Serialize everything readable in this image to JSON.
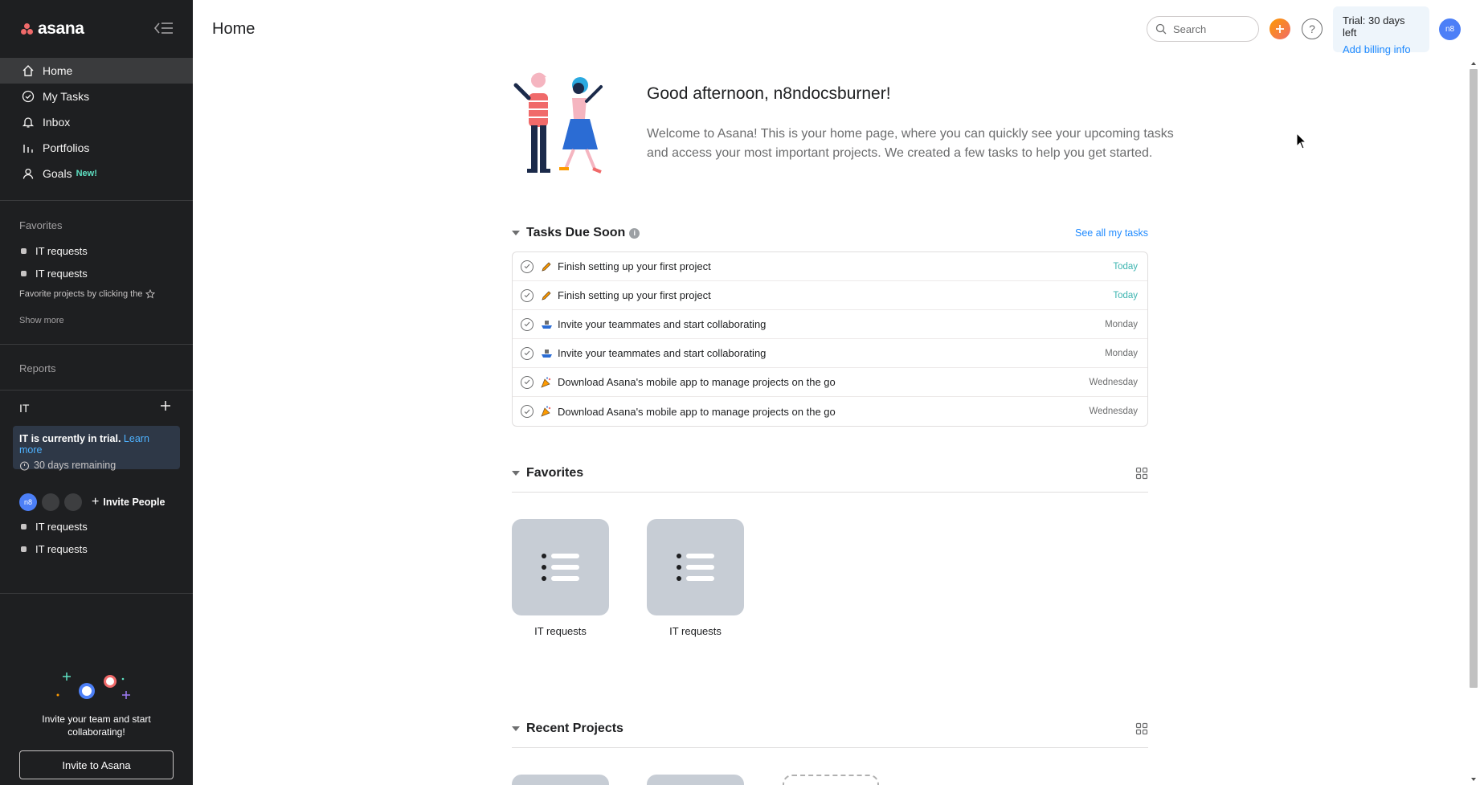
{
  "app": {
    "logo_text": "asana",
    "brand_color": "#f06a6a",
    "sidebar_bg": "#1e1f21"
  },
  "sidebar": {
    "nav": [
      {
        "label": "Home",
        "icon": "home-icon",
        "active": true
      },
      {
        "label": "My Tasks",
        "icon": "check-circle-icon"
      },
      {
        "label": "Inbox",
        "icon": "bell-icon"
      },
      {
        "label": "Portfolios",
        "icon": "bar-chart-icon"
      },
      {
        "label": "Goals",
        "icon": "person-icon",
        "badge": "New!"
      }
    ],
    "favorites_title": "Favorites",
    "favorites": [
      "IT requests",
      "IT requests"
    ],
    "favorite_hint": "Favorite projects by clicking the",
    "show_more": "Show more",
    "reports_title": "Reports",
    "team": {
      "name": "IT",
      "trial_text": "IT is currently in trial.",
      "learn_more": "Learn more",
      "remaining": "30 days remaining",
      "avatar_initials": "n8",
      "invite_people": "Invite People",
      "projects": [
        "IT requests",
        "IT requests"
      ]
    },
    "invite": {
      "text": "Invite your team and start collaborating!",
      "button": "Invite to Asana"
    }
  },
  "header": {
    "title": "Home",
    "search_placeholder": "Search",
    "trial_text": "Trial: 30 days left",
    "billing_link": "Add billing info",
    "avatar_initials": "n8"
  },
  "main": {
    "greeting": "Good afternoon, n8ndocsburner!",
    "welcome": "Welcome to Asana! This is your home page, where you can quickly see your upcoming tasks and access your most important projects. We created a few tasks to help you get started.",
    "tasks_section": {
      "title": "Tasks Due Soon",
      "see_all": "See all my tasks",
      "tasks": [
        {
          "name": "Finish setting up your first project",
          "due": "Today",
          "icon": "pencil-icon"
        },
        {
          "name": "Finish setting up your first project",
          "due": "Today",
          "icon": "pencil-icon"
        },
        {
          "name": "Invite your teammates and start collaborating",
          "due": "Monday",
          "icon": "ship-icon"
        },
        {
          "name": "Invite your teammates and start collaborating",
          "due": "Monday",
          "icon": "ship-icon"
        },
        {
          "name": "Download Asana's mobile app to manage projects on the go",
          "due": "Wednesday",
          "icon": "party-icon"
        },
        {
          "name": "Download Asana's mobile app to manage projects on the go",
          "due": "Wednesday",
          "icon": "party-icon"
        }
      ]
    },
    "favorites_section": {
      "title": "Favorites",
      "projects": [
        "IT requests",
        "IT requests"
      ]
    },
    "recent_section": {
      "title": "Recent Projects"
    }
  }
}
